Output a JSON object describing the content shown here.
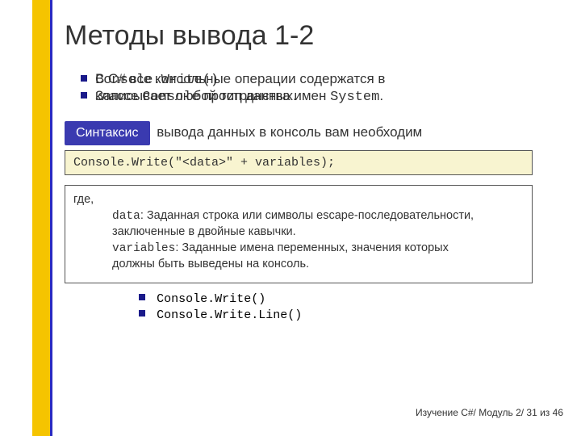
{
  "title": "Методы вывода 1-2",
  "overlap": {
    "bg_line1_a": "В C# ",
    "bg_line1_rest": "все консольные операции содержатся в",
    "fg_line1_mono": "Console.Write()",
    "bg_line2_a": "классе ",
    "bg_line2_mono": "Console",
    "bg_line2_b": " пространства имен ",
    "bg_line2_mono2": "System",
    "bg_line2_c": ".",
    "fg_line2": "Записывает любой тип данных."
  },
  "syntax": {
    "label": "Синтаксис",
    "trail": " вывода данных в консоль вам необходим",
    "code": "Console.Write(\"<data>\" + variables);"
  },
  "where": {
    "lead": "где,",
    "data_key": "data",
    "data_text": ": Заданная строка или символы escape-последовательности,",
    "data_text2": "заключенные в двойные кавычки.",
    "vars_key": "variables",
    "vars_text": ": Заданные имена переменных, значения которых",
    "vars_text2": " должны быть выведены на консоль."
  },
  "methods": {
    "m1": "Console.Write()",
    "m2": "Console.Write.Line()"
  },
  "footer": "Изучение C#/ Модуль 2/ 31 из 46"
}
